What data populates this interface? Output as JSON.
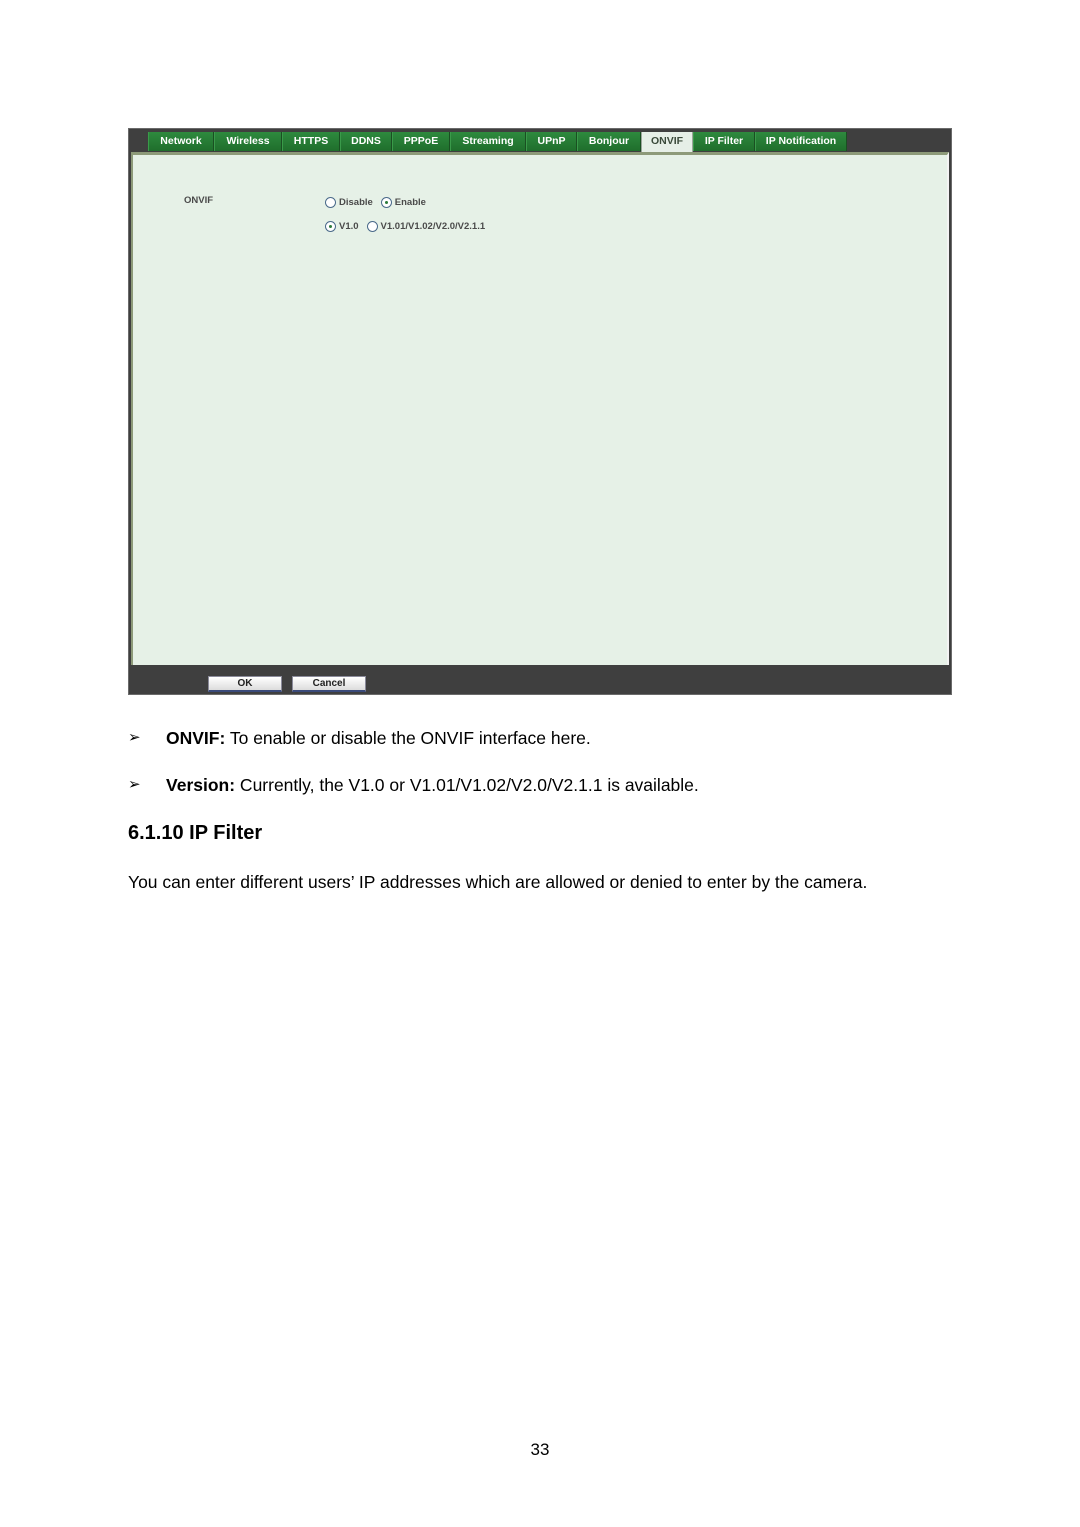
{
  "screenshot": {
    "tabs": [
      {
        "label": "Network",
        "active": false
      },
      {
        "label": "Wireless",
        "active": false
      },
      {
        "label": "HTTPS",
        "active": false
      },
      {
        "label": "DDNS",
        "active": false
      },
      {
        "label": "PPPoE",
        "active": false
      },
      {
        "label": "Streaming",
        "active": false
      },
      {
        "label": "UPnP",
        "active": false
      },
      {
        "label": "Bonjour",
        "active": false
      },
      {
        "label": "ONVIF",
        "active": true
      },
      {
        "label": "IP Filter",
        "active": false
      },
      {
        "label": "IP Notification",
        "active": false
      }
    ],
    "onvif_label": "ONVIF",
    "state_options": [
      {
        "label": "Disable",
        "selected": false
      },
      {
        "label": "Enable",
        "selected": true
      }
    ],
    "version_options": [
      {
        "label": "V1.0",
        "selected": true
      },
      {
        "label": "V1.01/V1.02/V2.0/V2.1.1",
        "selected": false
      }
    ],
    "ok_label": "OK",
    "cancel_label": "Cancel"
  },
  "bullets": [
    {
      "term": "ONVIF:",
      "text": " To enable or disable the ONVIF interface here."
    },
    {
      "term": "Version:",
      "text": " Currently, the  V1.0 or V1.01/V1.02/V2.0/V2.1.1 is available."
    }
  ],
  "arrow_glyph": "➢",
  "section_heading": "6.1.10 IP Filter",
  "paragraph": "You can enter different users’ IP addresses which are allowed or denied to enter by the camera.",
  "page_number": "33"
}
